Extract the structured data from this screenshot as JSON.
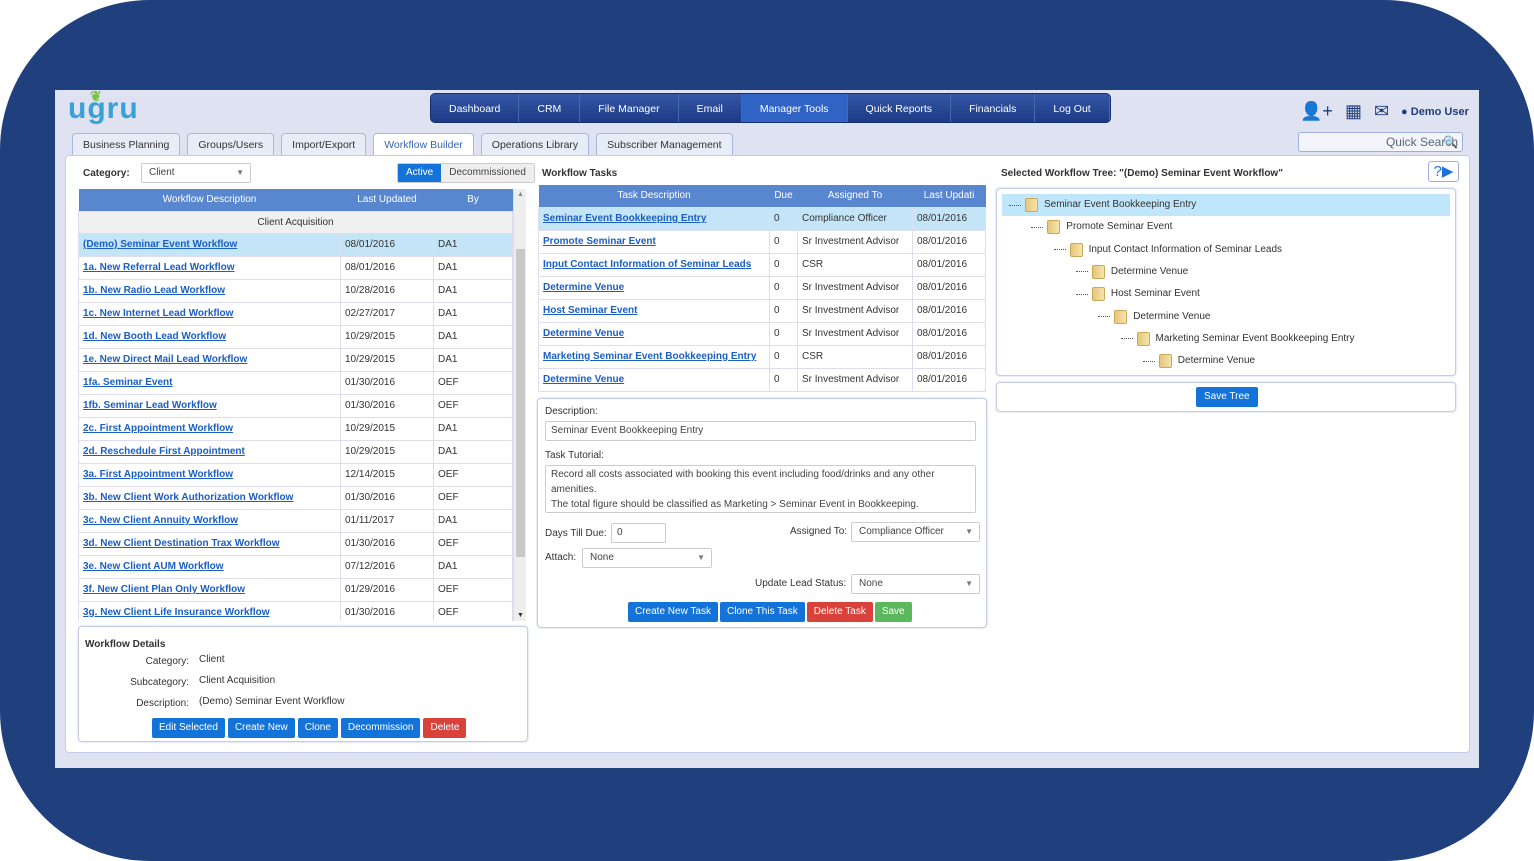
{
  "app": {
    "logo": "ugru"
  },
  "nav": {
    "items": [
      "Dashboard",
      "CRM",
      "File Manager",
      "Email",
      "Manager Tools",
      "Quick Reports",
      "Financials",
      "Log Out"
    ],
    "active": "Manager Tools"
  },
  "header": {
    "user": "Demo User",
    "icons": [
      "add-user-icon",
      "calendar-icon",
      "mail-icon",
      "user-icon"
    ],
    "search_placeholder": "Quick Search"
  },
  "tabs": {
    "items": [
      "Business Planning",
      "Groups/Users",
      "Import/Export",
      "Workflow Builder",
      "Operations Library",
      "Subscriber Management"
    ],
    "active": "Workflow Builder"
  },
  "left": {
    "category_label": "Category:",
    "category_value": "Client",
    "toggle": [
      "Active",
      "Decommissioned"
    ],
    "columns": [
      "Workflow Description",
      "Last Updated",
      "By"
    ],
    "group": "Client Acquisition",
    "rows": [
      [
        "(Demo) Seminar Event Workflow",
        "08/01/2016",
        "DA1"
      ],
      [
        "1a. New Referral Lead Workflow",
        "08/01/2016",
        "DA1"
      ],
      [
        "1b. New Radio Lead Workflow",
        "10/28/2016",
        "DA1"
      ],
      [
        "1c. New Internet Lead Workflow",
        "02/27/2017",
        "DA1"
      ],
      [
        "1d. New Booth Lead Workflow",
        "10/29/2015",
        "DA1"
      ],
      [
        "1e. New Direct Mail Lead Workflow",
        "10/29/2015",
        "DA1"
      ],
      [
        "1fa. Seminar Event",
        "01/30/2016",
        "OEF"
      ],
      [
        "1fb. Seminar Lead Workflow",
        "01/30/2016",
        "OEF"
      ],
      [
        "2c. First Appointment Workflow",
        "10/29/2015",
        "DA1"
      ],
      [
        "2d. Reschedule First Appointment",
        "10/29/2015",
        "DA1"
      ],
      [
        "3a. First Appointment Workflow",
        "12/14/2015",
        "OEF"
      ],
      [
        "3b. New Client Work Authorization Workflow",
        "01/30/2016",
        "OEF"
      ],
      [
        "3c. New Client Annuity Workflow",
        "01/11/2017",
        "DA1"
      ],
      [
        "3d. New Client Destination Trax Workflow",
        "01/30/2016",
        "OEF"
      ],
      [
        "3e. New Client AUM Workflow",
        "07/12/2016",
        "DA1"
      ],
      [
        "3f. New Client Plan Only Workflow",
        "01/29/2016",
        "OEF"
      ],
      [
        "3g. New Client Life Insurance Workflow",
        "01/30/2016",
        "OEF"
      ]
    ]
  },
  "details": {
    "title": "Workflow Details",
    "fields": [
      [
        "Category:",
        "Client"
      ],
      [
        "Subcategory:",
        "Client Acquisition"
      ],
      [
        "Description:",
        "(Demo) Seminar Event Workflow"
      ]
    ],
    "buttons": [
      "Edit Selected",
      "Create New",
      "Clone",
      "Decommission",
      "Delete"
    ]
  },
  "tasks": {
    "title": "Workflow Tasks",
    "columns": [
      "Task Description",
      "Due",
      "Assigned To",
      "Last Updati"
    ],
    "rows": [
      [
        "Seminar Event Bookkeeping Entry",
        "0",
        "Compliance Officer",
        "08/01/2016"
      ],
      [
        "Promote Seminar Event",
        "0",
        "Sr Investment Advisor",
        "08/01/2016"
      ],
      [
        "Input Contact Information of Seminar Leads",
        "0",
        "CSR",
        "08/01/2016"
      ],
      [
        "Determine Venue",
        "0",
        "Sr Investment Advisor",
        "08/01/2016"
      ],
      [
        "Host Seminar Event",
        "0",
        "Sr Investment Advisor",
        "08/01/2016"
      ],
      [
        "Determine Venue",
        "0",
        "Sr Investment Advisor",
        "08/01/2016"
      ],
      [
        "Marketing Seminar Event Bookkeeping Entry",
        "0",
        "CSR",
        "08/01/2016"
      ],
      [
        "Determine Venue",
        "0",
        "Sr Investment Advisor",
        "08/01/2016"
      ]
    ]
  },
  "form": {
    "description_label": "Description:",
    "description": "Seminar Event Bookkeeping Entry",
    "tutorial_label": "Task Tutorial:",
    "tutorial_lines": [
      "Record all costs associated with booking this event including food/drinks and any other",
      "amenities.",
      "The total figure should be classified as Marketing > Seminar Event in Bookkeeping."
    ],
    "days_label": "Days Till Due:",
    "days": "0",
    "assigned_label": "Assigned To:",
    "assigned": "Compliance Officer",
    "attach_label": "Attach:",
    "attach": "None",
    "lead_label": "Update Lead Status:",
    "lead": "None",
    "buttons": [
      "Create New Task",
      "Clone This Task",
      "Delete Task",
      "Save"
    ]
  },
  "tree": {
    "title": "Selected Workflow Tree: \"(Demo) Seminar Event Workflow\"",
    "help": "?",
    "items": [
      {
        "label": "Seminar Event Bookkeeping Entry",
        "level": 0
      },
      {
        "label": "Promote Seminar Event",
        "level": 1
      },
      {
        "label": "Input Contact Information of Seminar Leads",
        "level": 2
      },
      {
        "label": "Determine Venue",
        "level": 3
      },
      {
        "label": "Host Seminar Event",
        "level": 3
      },
      {
        "label": "Determine Venue",
        "level": 4
      },
      {
        "label": "Marketing Seminar Event Bookkeeping Entry",
        "level": 5
      },
      {
        "label": "Determine Venue",
        "level": 6
      }
    ],
    "save": "Save Tree"
  }
}
